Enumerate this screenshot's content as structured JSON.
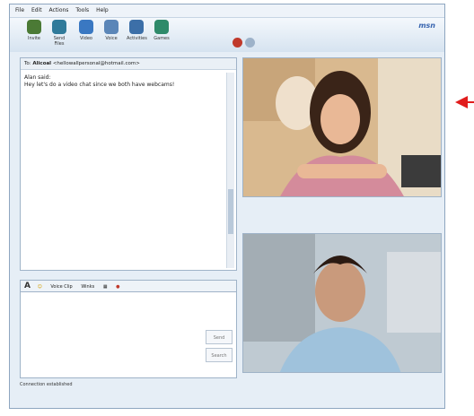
{
  "menu": [
    "File",
    "Edit",
    "Actions",
    "Tools",
    "Help"
  ],
  "toolbar": {
    "buttons": [
      {
        "label": "Invite",
        "icon": "invite-icon"
      },
      {
        "label": "Send Files",
        "icon": "send-files-icon"
      },
      {
        "label": "Video",
        "icon": "video-icon"
      },
      {
        "label": "Voice",
        "icon": "voice-icon"
      },
      {
        "label": "Activities",
        "icon": "activities-icon"
      },
      {
        "label": "Games",
        "icon": "games-icon"
      }
    ],
    "brand": "msn"
  },
  "chat": {
    "to_label": "To:",
    "to_name": "Alicoal",
    "to_email": "<hellowallpersonal@hotmail.com>",
    "messages": [
      {
        "sender": "Alan said:",
        "text": "Hey let's do a video chat since we both have webcams!"
      }
    ]
  },
  "compose": {
    "toolbar_items": [
      "A",
      "☺",
      "Voice Clip",
      "Winks",
      "▦",
      "●"
    ],
    "send_label": "Send",
    "search_label": "Search"
  },
  "status": {
    "text": "Connection established"
  },
  "accent": {
    "arrow": "#e11c1c",
    "brand": "#3a66b0"
  }
}
